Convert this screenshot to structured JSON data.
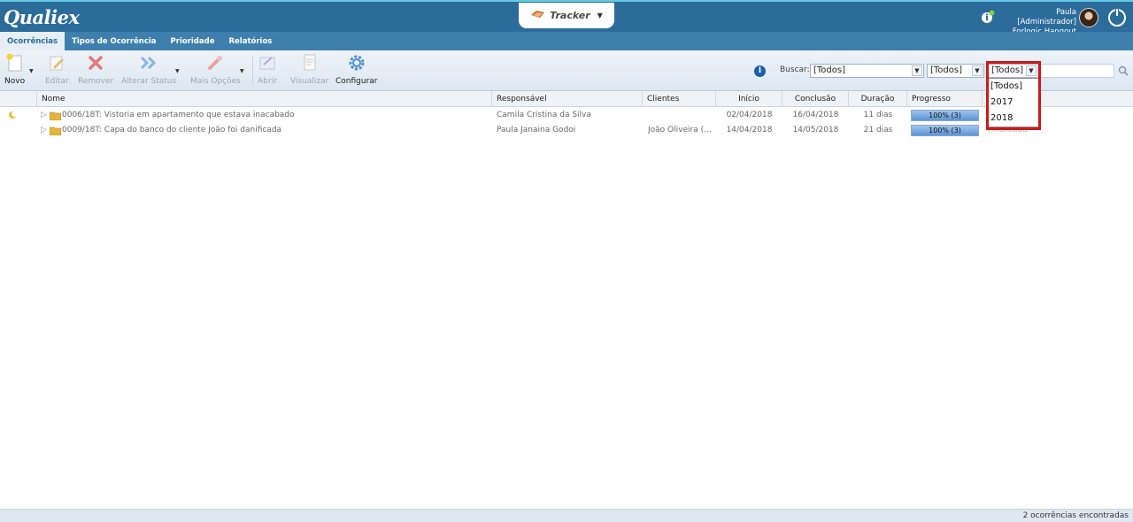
{
  "app": {
    "logo": "Qualiex",
    "module": "Tracker"
  },
  "user": {
    "name": "Paula [Administrador]",
    "org": "Forlogic Hangout"
  },
  "menu": [
    "Ocorrências",
    "Tipos de Ocorrência",
    "Prioridade",
    "Relatórios"
  ],
  "toolbar": {
    "novo": "Novo",
    "editar": "Editar",
    "remover": "Remover",
    "alterar_status": "Alterar Status",
    "mais_opcoes": "Mais Opções",
    "abrir": "Abrir",
    "visualizar": "Visualizar",
    "configurar": "Configurar"
  },
  "search": {
    "label": "Buscar:",
    "filter1": "[Todos]",
    "filter2": "[Todos]",
    "filter3": "[Todos]",
    "year_options": [
      "[Todos]",
      "2017",
      "2018"
    ]
  },
  "grid": {
    "columns": {
      "nome": "Nome",
      "responsavel": "Responsável",
      "clientes": "Clientes",
      "inicio": "Início",
      "conclusao": "Conclusão",
      "duracao": "Duração",
      "progresso": "Progresso"
    },
    "rows": [
      {
        "nome": "0006/18T: Vistoria em apartamento que estava inacabado",
        "responsavel": "Camila Cristina da Silva",
        "clientes": "",
        "inicio": "02/04/2018",
        "conclusao": "16/04/2018",
        "duracao": "11 dias",
        "progresso": "100% (3)",
        "progress_value": 1.0,
        "status": ""
      },
      {
        "nome": "0009/18T: Capa do banco do cliente João foi danificada",
        "responsavel": "Paula Janaina Godoi",
        "clientes": "João Oliveira (v...",
        "inicio": "14/04/2018",
        "conclusao": "14/05/2018",
        "duracao": "21 dias",
        "progresso": "100% (3)",
        "progress_value": 1.0,
        "status": "Finalizada"
      }
    ]
  },
  "footer": {
    "count": "2 ocorrências encontradas"
  },
  "colors": {
    "topbar": "#2b6c9a",
    "menubar": "#3f7fae",
    "highlight": "#d01818",
    "progress": "#5c95d6"
  }
}
